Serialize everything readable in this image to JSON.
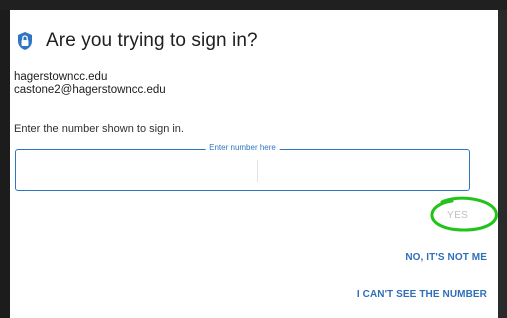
{
  "dialog": {
    "title": "Are you trying to sign in?",
    "title_icon": "shield-lock-icon",
    "account": {
      "domain": "hagerstowncc.edu",
      "email": "castone2@hagerstowncc.edu"
    },
    "instruction": "Enter the number shown to sign in.",
    "number_field": {
      "legend": "Enter number here",
      "value": ""
    },
    "buttons": {
      "yes": "YES",
      "no": "NO, IT'S NOT ME",
      "cant_see": "I CAN'T SEE THE NUMBER"
    },
    "annotation": "green-hand-drawn-circle"
  },
  "colors": {
    "accent": "#2f76c1",
    "link": "#2f6fba",
    "disabled": "#c0c0c0",
    "annotation": "#22c41a",
    "background": "#1c1c1c"
  }
}
